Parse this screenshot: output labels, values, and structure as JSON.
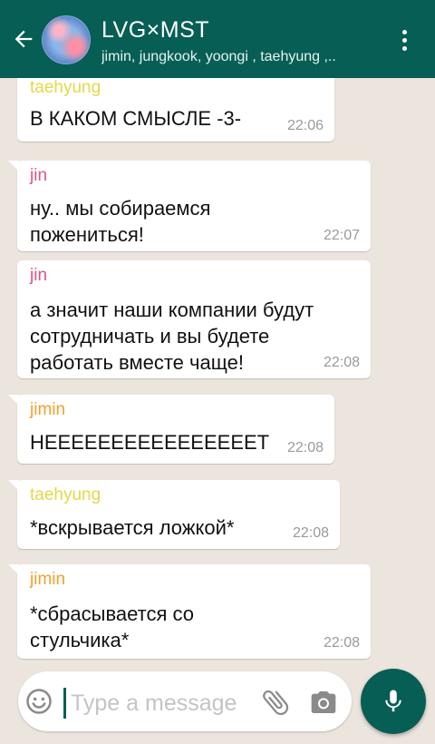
{
  "header": {
    "title": "LVG×MST",
    "subtitle": "jimin, jungkook, yoongi , taehyung ,.."
  },
  "messages": [
    {
      "sender": "taehyung",
      "sender_color": "#e5d74a",
      "text": "В КАКОМ СМЫСЛЕ -3-",
      "time": "22:06"
    },
    {
      "sender": "jin",
      "sender_color": "#e05580",
      "text": "ну.. мы собираемся\nпожениться!",
      "time": "22:07"
    },
    {
      "sender": "jin",
      "sender_color": "#e05580",
      "text": "а значит наши компании будут\nсотрудничать и вы будете\nработать вместе чаще!",
      "time": "22:08"
    },
    {
      "sender": "jimin",
      "sender_color": "#f0a030",
      "text": "НЕЕЕЕЕЕЕЕЕЕЕЕЕЕЕЕТ",
      "time": "22:08"
    },
    {
      "sender": "taehyung",
      "sender_color": "#e5d74a",
      "text": "*вскрывается ложкой*",
      "time": "22:08"
    },
    {
      "sender": "jimin",
      "sender_color": "#f0a030",
      "text": "*сбрасывается со\nстульчика*",
      "time": "22:08"
    }
  ],
  "input": {
    "placeholder": "Type a message"
  },
  "icons": {
    "back": "arrow-left-icon",
    "menu": "more-vert-icon",
    "emoji": "smiley-icon",
    "attach": "paperclip-icon",
    "camera": "camera-icon",
    "mic": "microphone-icon"
  },
  "colors": {
    "header": "#075e54",
    "chat_bg": "#ece5dd",
    "bubble": "#ffffff"
  }
}
